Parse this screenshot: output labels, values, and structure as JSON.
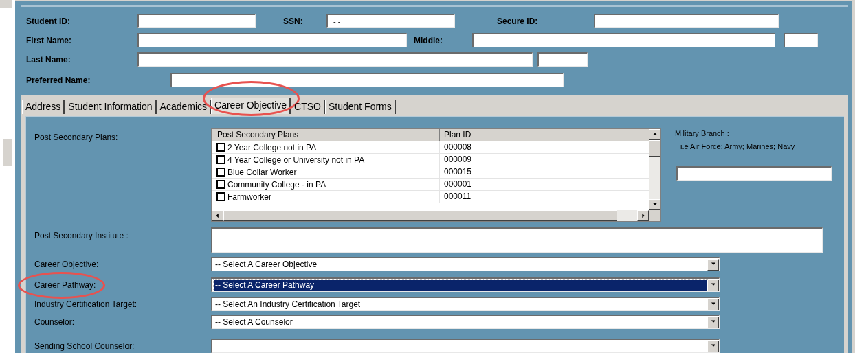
{
  "header_fields": [
    [
      {
        "kind": "label",
        "text": "Student ID:"
      },
      {
        "kind": "input"
      },
      {
        "kind": "label",
        "text": "SSN:"
      },
      {
        "kind": "input",
        "value": "- -"
      },
      {
        "kind": "label",
        "text": "Secure ID:"
      },
      {
        "kind": "input"
      }
    ],
    [
      {
        "kind": "label",
        "text": "First Name:"
      },
      {
        "kind": "input"
      },
      {
        "kind": "label",
        "text": "Middle:"
      },
      {
        "kind": "input"
      },
      {
        "kind": "input"
      }
    ],
    [
      {
        "kind": "label",
        "text": "Last Name:"
      },
      {
        "kind": "input"
      },
      {
        "kind": "input"
      }
    ],
    [
      {
        "kind": "label",
        "text": "Preferred Name:"
      },
      {
        "kind": "input"
      }
    ]
  ],
  "tabs": [
    {
      "label": "Address",
      "selected": false,
      "circled": false
    },
    {
      "label": "Student Information",
      "selected": false,
      "circled": false
    },
    {
      "label": "Academics",
      "selected": false,
      "circled": false
    },
    {
      "label": "Career Objective",
      "selected": true,
      "circled": true
    },
    {
      "label": "CTSO",
      "selected": false,
      "circled": false
    },
    {
      "label": "Student Forms",
      "selected": false,
      "circled": false
    }
  ],
  "post_secondary_plans": {
    "label": "Post Secondary Plans:",
    "columns": [
      "Post Secondary Plans",
      "Plan ID"
    ],
    "rows": [
      {
        "plan": "2 Year College not in PA",
        "plan_id": "000008",
        "checked": false
      },
      {
        "plan": "4 Year College or University not in PA",
        "plan_id": "000009",
        "checked": false
      },
      {
        "plan": "Blue Collar Worker",
        "plan_id": "000015",
        "checked": false
      },
      {
        "plan": "Community College - in PA",
        "plan_id": "000001",
        "checked": false
      },
      {
        "plan": "Farmworker",
        "plan_id": "000011",
        "checked": false
      }
    ]
  },
  "military_branch": {
    "label": "Military Branch :",
    "hint": "i.e Air Force; Army; Marines; Navy"
  },
  "post_secondary_institute": {
    "label": "Post Secondary Institute :"
  },
  "dropdowns": [
    {
      "label": "Career Objective:",
      "value": "-- Select A Career Objective",
      "selected": false,
      "circled": false
    },
    {
      "label": "Career Pathway:",
      "value": "-- Select A Career Pathway",
      "selected": true,
      "circled": true
    },
    {
      "label": "Industry Certification Target:",
      "value": "-- Select An Industry Certification Target",
      "selected": false,
      "circled": false
    },
    {
      "label": "Counselor:",
      "value": "-- Select A Counselor",
      "selected": false,
      "circled": false
    },
    {
      "label": "Sending School Counselor:",
      "selected": false,
      "circled": false
    }
  ]
}
